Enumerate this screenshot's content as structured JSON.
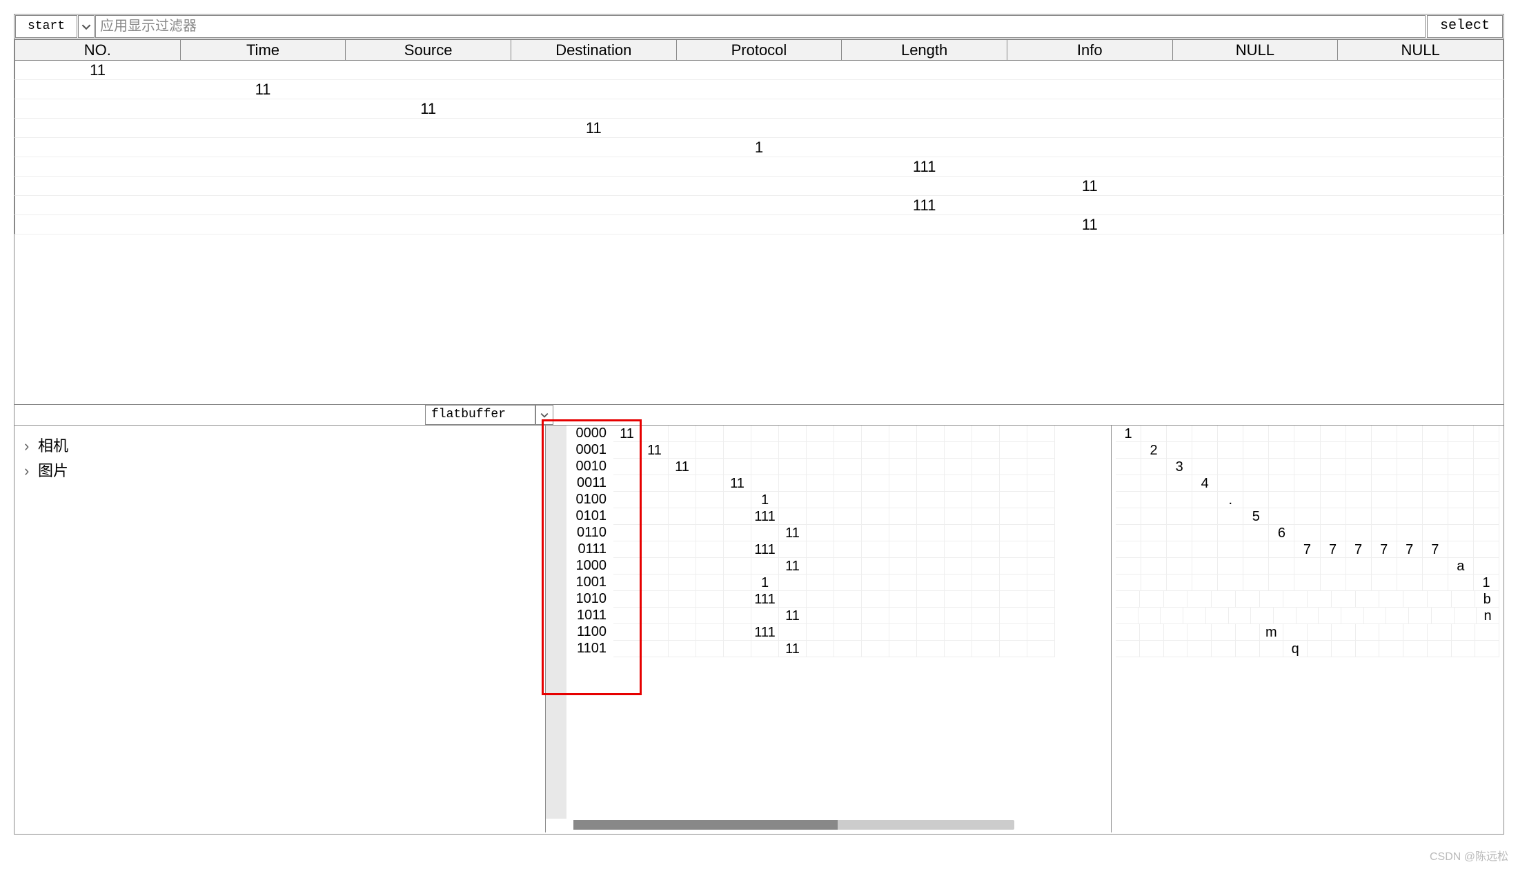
{
  "toolbar": {
    "start_label": "start",
    "filter_placeholder": "应用显示过滤器",
    "select_label": "select"
  },
  "packet_table": {
    "headers": [
      "NO.",
      "Time",
      "Source",
      "Destination",
      "Protocol",
      "Length",
      "Info",
      "NULL",
      "NULL"
    ],
    "rows": [
      [
        "11",
        "",
        "",
        "",
        "",
        "",
        "",
        "",
        ""
      ],
      [
        "",
        "11",
        "",
        "",
        "",
        "",
        "",
        "",
        ""
      ],
      [
        "",
        "",
        "11",
        "",
        "",
        "",
        "",
        "",
        ""
      ],
      [
        "",
        "",
        "",
        "11",
        "",
        "",
        "",
        "",
        ""
      ],
      [
        "",
        "",
        "",
        "",
        "1",
        "",
        "",
        "",
        ""
      ],
      [
        "",
        "",
        "",
        "",
        "",
        "111",
        "",
        "",
        ""
      ],
      [
        "",
        "",
        "",
        "",
        "",
        "",
        "11",
        "",
        ""
      ],
      [
        "",
        "",
        "",
        "",
        "",
        "111",
        "",
        "",
        ""
      ],
      [
        "",
        "",
        "",
        "",
        "",
        "",
        "11",
        "",
        ""
      ]
    ]
  },
  "middle": {
    "label": "flatbuffer"
  },
  "tree": {
    "items": [
      "相机",
      "图片"
    ]
  },
  "hex": {
    "rows": [
      {
        "offset": "0000",
        "cells": [
          "11",
          "",
          "",
          "",
          "",
          "",
          "",
          "",
          "",
          "",
          "",
          "",
          "",
          "",
          "",
          ""
        ]
      },
      {
        "offset": "0001",
        "cells": [
          "",
          "11",
          "",
          "",
          "",
          "",
          "",
          "",
          "",
          "",
          "",
          "",
          "",
          "",
          "",
          ""
        ]
      },
      {
        "offset": "0010",
        "cells": [
          "",
          "",
          "11",
          "",
          "",
          "",
          "",
          "",
          "",
          "",
          "",
          "",
          "",
          "",
          "",
          ""
        ]
      },
      {
        "offset": "0011",
        "cells": [
          "",
          "",
          "",
          "",
          "11",
          "",
          "",
          "",
          "",
          "",
          "",
          "",
          "",
          "",
          "",
          ""
        ]
      },
      {
        "offset": "0100",
        "cells": [
          "",
          "",
          "",
          "",
          "",
          "1",
          "",
          "",
          "",
          "",
          "",
          "",
          "",
          "",
          "",
          ""
        ]
      },
      {
        "offset": "0101",
        "cells": [
          "",
          "",
          "",
          "",
          "",
          "111",
          "",
          "",
          "",
          "",
          "",
          "",
          "",
          "",
          "",
          ""
        ]
      },
      {
        "offset": "0110",
        "cells": [
          "",
          "",
          "",
          "",
          "",
          "",
          "11",
          "",
          "",
          "",
          "",
          "",
          "",
          "",
          "",
          ""
        ]
      },
      {
        "offset": "0111",
        "cells": [
          "",
          "",
          "",
          "",
          "",
          "111",
          "",
          "",
          "",
          "",
          "",
          "",
          "",
          "",
          "",
          ""
        ]
      },
      {
        "offset": "1000",
        "cells": [
          "",
          "",
          "",
          "",
          "",
          "",
          "11",
          "",
          "",
          "",
          "",
          "",
          "",
          "",
          "",
          ""
        ]
      },
      {
        "offset": "1001",
        "cells": [
          "",
          "",
          "",
          "",
          "",
          "1",
          "",
          "",
          "",
          "",
          "",
          "",
          "",
          "",
          "",
          ""
        ]
      },
      {
        "offset": "1010",
        "cells": [
          "",
          "",
          "",
          "",
          "",
          "111",
          "",
          "",
          "",
          "",
          "",
          "",
          "",
          "",
          "",
          ""
        ]
      },
      {
        "offset": "1011",
        "cells": [
          "",
          "",
          "",
          "",
          "",
          "",
          "11",
          "",
          "",
          "",
          "",
          "",
          "",
          "",
          "",
          ""
        ]
      },
      {
        "offset": "1100",
        "cells": [
          "",
          "",
          "",
          "",
          "",
          "111",
          "",
          "",
          "",
          "",
          "",
          "",
          "",
          "",
          "",
          ""
        ]
      },
      {
        "offset": "1101",
        "cells": [
          "",
          "",
          "",
          "",
          "",
          "",
          "11",
          "",
          "",
          "",
          "",
          "",
          "",
          "",
          "",
          ""
        ]
      }
    ]
  },
  "ascii": {
    "rows": [
      [
        "1",
        "",
        "",
        "",
        "",
        "",
        "",
        "",
        "",
        "",
        "",
        "",
        "",
        "",
        ""
      ],
      [
        "",
        "2",
        "",
        "",
        "",
        "",
        "",
        "",
        "",
        "",
        "",
        "",
        "",
        "",
        ""
      ],
      [
        "",
        "",
        "3",
        "",
        "",
        "",
        "",
        "",
        "",
        "",
        "",
        "",
        "",
        "",
        ""
      ],
      [
        "",
        "",
        "",
        "4",
        "",
        "",
        "",
        "",
        "",
        "",
        "",
        "",
        "",
        "",
        ""
      ],
      [
        "",
        "",
        "",
        "",
        ".",
        "",
        "",
        "",
        "",
        "",
        "",
        "",
        "",
        "",
        ""
      ],
      [
        "",
        "",
        "",
        "",
        "",
        "5",
        "",
        "",
        "",
        "",
        "",
        "",
        "",
        "",
        ""
      ],
      [
        "",
        "",
        "",
        "",
        "",
        "",
        "6",
        "",
        "",
        "",
        "",
        "",
        "",
        "",
        ""
      ],
      [
        "",
        "",
        "",
        "",
        "",
        "",
        "",
        "7",
        "7",
        "7",
        "7",
        "7",
        "7",
        "",
        ""
      ],
      [
        "",
        "",
        "",
        "",
        "",
        "",
        "",
        "",
        "",
        "",
        "",
        "",
        "",
        "a",
        ""
      ],
      [
        "",
        "",
        "",
        "",
        "",
        "",
        "",
        "",
        "",
        "",
        "",
        "",
        "",
        "",
        "1"
      ],
      [
        "",
        "",
        "",
        "",
        "",
        "",
        "",
        "",
        "",
        "",
        "",
        "",
        "",
        "",
        "",
        "b"
      ],
      [
        "",
        "",
        "",
        "",
        "",
        "",
        "",
        "",
        "",
        "",
        "",
        "",
        "",
        "",
        "",
        "",
        "n"
      ],
      [
        "",
        "",
        "",
        "",
        "",
        "",
        "m",
        "",
        "",
        "",
        "",
        "",
        "",
        "",
        "",
        ""
      ],
      [
        "",
        "",
        "",
        "",
        "",
        "",
        "",
        "q",
        "",
        "",
        "",
        "",
        "",
        "",
        "",
        ""
      ]
    ]
  },
  "watermark": "CSDN @陈远松"
}
